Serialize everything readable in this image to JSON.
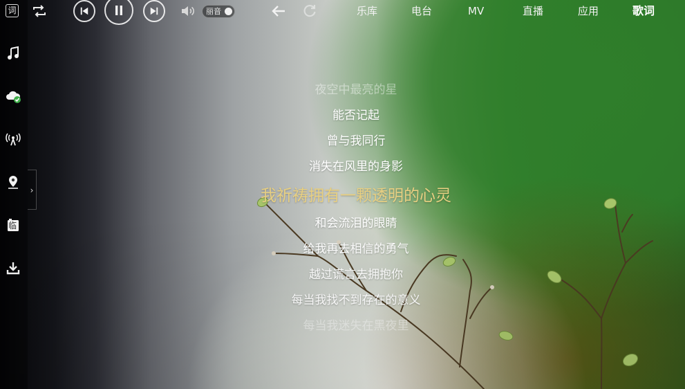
{
  "app": {
    "left_rail": {
      "top_badge": "词",
      "items": [
        {
          "icon": "music-note-icon"
        },
        {
          "icon": "cloud-check-icon"
        },
        {
          "icon": "radio-tower-icon"
        },
        {
          "icon": "location-pin-icon"
        },
        {
          "icon": "local-music-icon",
          "label": "临"
        },
        {
          "icon": "download-icon"
        }
      ],
      "collapse_glyph": "›"
    },
    "player": {
      "repeat_icon": "repeat-icon",
      "prev_icon": "previous-track-icon",
      "play_state_icon": "pause-icon",
      "next_icon": "next-track-icon",
      "volume_icon": "volume-icon",
      "sound_effect_label": "丽音"
    },
    "nav": {
      "back_icon": "back-arrow-icon",
      "refresh_icon": "refresh-icon",
      "tabs": [
        {
          "label": "乐库"
        },
        {
          "label": "电台"
        },
        {
          "label": "MV"
        },
        {
          "label": "直播"
        },
        {
          "label": "应用"
        },
        {
          "label": "歌词",
          "active": true
        }
      ]
    },
    "lyrics": {
      "lines": [
        {
          "text": "夜空中最亮的星",
          "state": "past"
        },
        {
          "text": "能否记起",
          "state": "normal"
        },
        {
          "text": "曾与我同行",
          "state": "normal"
        },
        {
          "text": "消失在风里的身影",
          "state": "normal"
        },
        {
          "text": "我祈祷拥有一颗透明的心灵",
          "state": "current"
        },
        {
          "text": "和会流泪的眼睛",
          "state": "normal"
        },
        {
          "text": "给我再去相信的勇气",
          "state": "normal"
        },
        {
          "text": "越过谎言去拥抱你",
          "state": "normal"
        },
        {
          "text": "每当我找不到存在的意义",
          "state": "normal"
        },
        {
          "text": "每当我迷失在黑夜里",
          "state": "upcoming"
        }
      ],
      "current_color": "#e7cf82"
    },
    "colors": {
      "accent_green": "#2f7e2b",
      "lyric_white": "#ffffff"
    }
  }
}
